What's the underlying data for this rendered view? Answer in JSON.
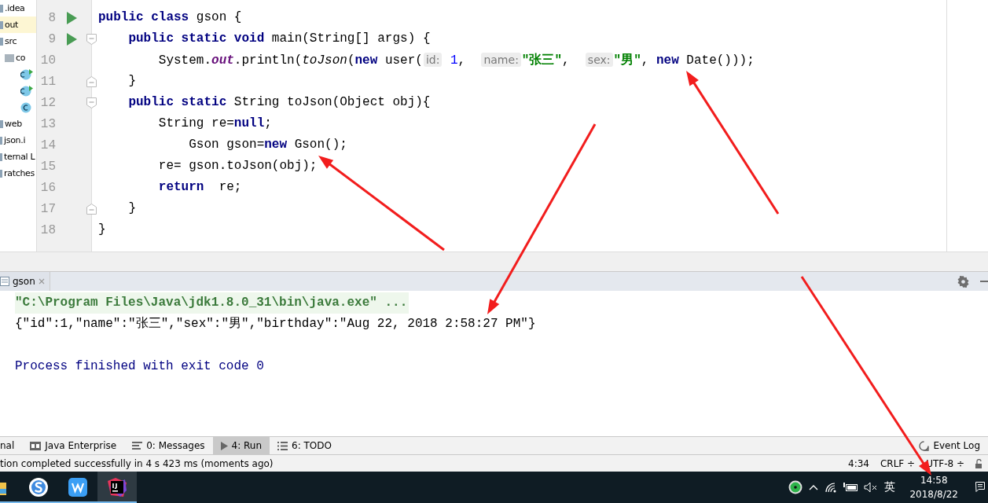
{
  "project_tree": {
    "items": [
      {
        "label": ".idea",
        "kind": "folder",
        "selected": false
      },
      {
        "label": "out",
        "kind": "folder",
        "selected": true
      },
      {
        "label": "src",
        "kind": "folder",
        "selected": false,
        "children": [
          {
            "label": "co",
            "kind": "package",
            "selected": false,
            "children": [
              {
                "kind": "runnable-class",
                "selected": false
              },
              {
                "kind": "runnable-class",
                "selected": false
              },
              {
                "kind": "class",
                "selected": false
              }
            ]
          }
        ]
      },
      {
        "label": "web",
        "kind": "folder",
        "selected": false
      },
      {
        "label": "json.i",
        "kind": "file",
        "selected": false
      },
      {
        "label": "ternal L",
        "kind": "file",
        "selected": false
      },
      {
        "label": "ratches",
        "kind": "file",
        "selected": false
      }
    ]
  },
  "editor": {
    "lines": [
      {
        "number": "8",
        "run": true,
        "fold_start": false,
        "fold_end": false,
        "tokens": [
          {
            "kind": "kw",
            "text": "public class "
          },
          {
            "kind": "plain",
            "text": "gson {"
          }
        ]
      },
      {
        "number": "9",
        "run": true,
        "fold_start": true,
        "fold_end": false,
        "tokens": [
          {
            "kind": "kw",
            "text": "    public static void "
          },
          {
            "kind": "plain",
            "text": "main(String[] args) {"
          }
        ]
      },
      {
        "number": "10",
        "run": false,
        "fold_start": false,
        "fold_end": false,
        "tokens": [
          {
            "kind": "plain",
            "text": "        System."
          },
          {
            "kind": "field",
            "text": "out"
          },
          {
            "kind": "plain",
            "text": ".println("
          },
          {
            "kind": "italic",
            "text": "toJson"
          },
          {
            "kind": "plain",
            "text": "("
          },
          {
            "kind": "kw",
            "text": "new"
          },
          {
            "kind": "plain",
            "text": " user("
          },
          {
            "kind": "hint",
            "text": "id:"
          },
          {
            "kind": "num",
            "text": " 1"
          },
          {
            "kind": "plain",
            "text": ",  "
          },
          {
            "kind": "hint",
            "text": "name:"
          },
          {
            "kind": "str",
            "text": "\"张三\""
          },
          {
            "kind": "plain",
            "text": ",  "
          },
          {
            "kind": "hint",
            "text": "sex:"
          },
          {
            "kind": "str",
            "text": "\"男\""
          },
          {
            "kind": "plain",
            "text": ", "
          },
          {
            "kind": "kw",
            "text": "new"
          },
          {
            "kind": "plain",
            "text": " Date()));"
          }
        ]
      },
      {
        "number": "11",
        "run": false,
        "fold_start": false,
        "fold_end": true,
        "tokens": [
          {
            "kind": "plain",
            "text": "    }"
          }
        ]
      },
      {
        "number": "12",
        "run": false,
        "fold_start": true,
        "fold_end": false,
        "tokens": [
          {
            "kind": "kw",
            "text": "    public static "
          },
          {
            "kind": "plain",
            "text": "String toJson(Object obj){"
          }
        ]
      },
      {
        "number": "13",
        "run": false,
        "fold_start": false,
        "fold_end": false,
        "tokens": [
          {
            "kind": "plain",
            "text": "        String re="
          },
          {
            "kind": "kw",
            "text": "null"
          },
          {
            "kind": "plain",
            "text": ";"
          }
        ]
      },
      {
        "number": "14",
        "run": false,
        "fold_start": false,
        "fold_end": false,
        "tokens": [
          {
            "kind": "plain",
            "text": "            Gson gson="
          },
          {
            "kind": "kw",
            "text": "new"
          },
          {
            "kind": "plain",
            "text": " Gson();"
          }
        ]
      },
      {
        "number": "15",
        "run": false,
        "fold_start": false,
        "fold_end": false,
        "tokens": [
          {
            "kind": "plain",
            "text": "        re= gson.toJson(obj);"
          }
        ]
      },
      {
        "number": "16",
        "run": false,
        "fold_start": false,
        "fold_end": false,
        "tokens": [
          {
            "kind": "kw",
            "text": "        return"
          },
          {
            "kind": "plain",
            "text": "  re;"
          }
        ]
      },
      {
        "number": "17",
        "run": false,
        "fold_start": false,
        "fold_end": true,
        "tokens": [
          {
            "kind": "plain",
            "text": "    }"
          }
        ]
      },
      {
        "number": "18",
        "run": false,
        "fold_start": false,
        "fold_end": false,
        "tokens": [
          {
            "kind": "plain",
            "text": "}"
          }
        ]
      }
    ]
  },
  "run_panel": {
    "tab": "gson",
    "console": [
      {
        "kind": "command",
        "text": "\"C:\\Program Files\\Java\\jdk1.8.0_31\\bin\\java.exe\" ..."
      },
      {
        "kind": "output",
        "text": "{\"id\":1,\"name\":\"张三\",\"sex\":\"男\",\"birthday\":\"Aug 22, 2018 2:58:27 PM\"}"
      },
      {
        "kind": "exit",
        "text": "Process finished with exit code 0"
      }
    ]
  },
  "tool_tabs": [
    {
      "label": "nal",
      "kind": "none",
      "selected": false
    },
    {
      "label": "Java Enterprise",
      "kind": "enterprise",
      "selected": false
    },
    {
      "label": "0: Messages",
      "kind": "messages",
      "selected": false
    },
    {
      "label": "4: Run",
      "kind": "run",
      "selected": true
    },
    {
      "label": "6: TODO",
      "kind": "todo",
      "selected": false
    }
  ],
  "event_log": "Event Log",
  "status_bar": {
    "message": "tion completed successfully in 4 s 423 ms (moments ago)",
    "position": "4:34",
    "line_separator": "CRLF ÷",
    "encoding": "UTF-8 ÷"
  },
  "taskbar": {
    "apps": [
      {
        "kind": "folder",
        "selected": false
      },
      {
        "kind": "sogou",
        "selected": false
      },
      {
        "kind": "wps",
        "selected": false
      },
      {
        "kind": "intellij",
        "selected": true
      }
    ],
    "ime": "英",
    "time": "14:58",
    "date": "2018/8/22"
  }
}
